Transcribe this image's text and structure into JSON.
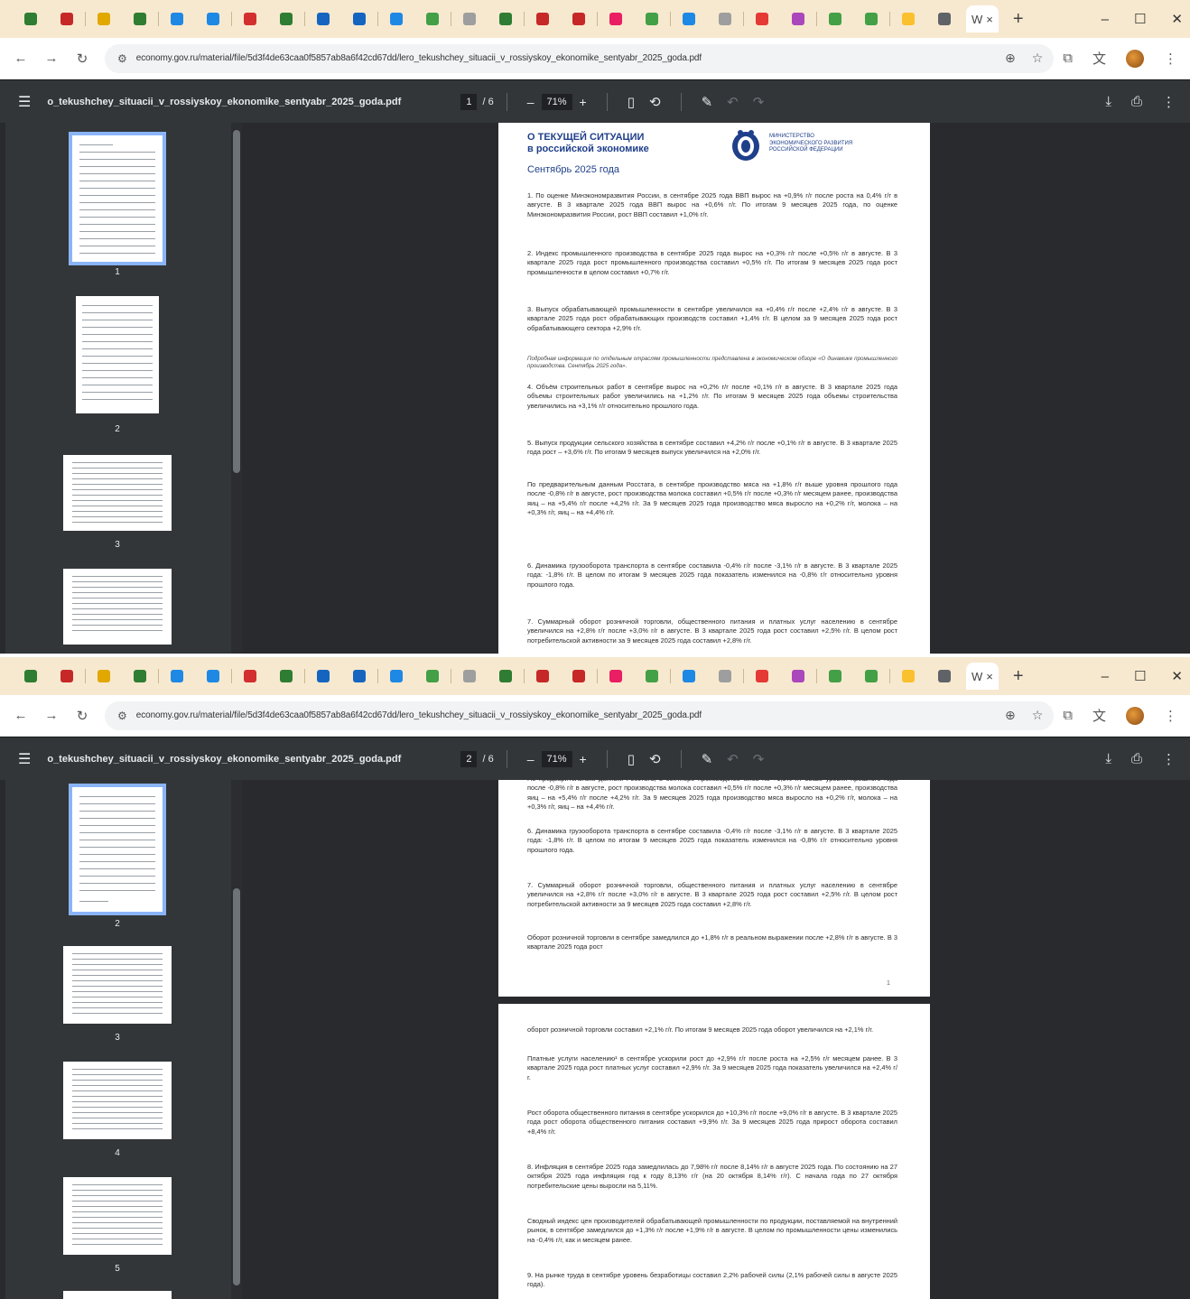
{
  "browser": {
    "pinned_tab_colors": [
      "#2e7d32",
      "#c62828",
      "#e0a800",
      "#2e7d32",
      "#1e88e5",
      "#1e88e5",
      "#d32f2f",
      "#2e7d32",
      "#1565c0",
      "#1565c0",
      "#1e88e5",
      "#43a047",
      "#9e9e9e",
      "#2e7d32",
      "#c62828",
      "#c62828",
      "#e91e63",
      "#43a047",
      "#1e88e5",
      "#9e9e9e",
      "#e53935",
      "#ab47bc",
      "#43a047",
      "#43a047",
      "#fbc02d",
      "#5f6368"
    ],
    "active_tab_icon": "W",
    "close_tab_glyph": "×",
    "new_tab_glyph": "+",
    "win_min": "–",
    "win_max": "☐",
    "win_close": "✕",
    "url": "economy.gov.ru/material/file/5d3f4de63caa0f5857ab8a6f42cd67dd/lero_tekushchey_situacii_v_rossiyskoy_ekonomike_sentyabr_2025_goda.pdf"
  },
  "pdf_viewer": {
    "file_name": "o_tekushchey_situacii_v_rossiyskoy_ekonomike_sentyabr_2025_goda.pdf",
    "total_pages": "/ 6",
    "zoom": "71%"
  },
  "screens": [
    {
      "current_page": "1",
      "thumb_labels": [
        "1",
        "2",
        "3"
      ]
    },
    {
      "current_page": "2",
      "thumb_labels": [
        "2",
        "3",
        "4",
        "5"
      ]
    }
  ],
  "document": {
    "title_line1": "О ТЕКУЩЕЙ СИТУАЦИИ",
    "title_line2": "в российской экономике",
    "subtitle": "Сентябрь 2025 года",
    "ministry_line1": "Министерство",
    "ministry_line2": "экономического развития",
    "ministry_line3": "Российской Федерации",
    "p1": "1. По оценке Минэкономразвития России, в сентябре 2025 года ВВП вырос на +0,9% г/г после роста на 0,4% г/г в августе. В 3 квартале 2025 года ВВП вырос на +0,6% г/г. По итогам 9 месяцев 2025 года, по оценке Минэкономразвития России, рост ВВП составил +1,0% г/г.",
    "p2": "2. Индекс промышленного производства в сентябре 2025 года вырос на +0,3% г/г после +0,5% г/г в августе. В 3 квартале 2025 года рост промышленного производства составил +0,5% г/г. По итогам 9 месяцев 2025 года рост промышленности в целом составил +0,7% г/г.",
    "p3": "3. Выпуск обрабатывающей промышленности в сентябре увеличился на +0,4% г/г после +2,4% г/г в августе. В 3 квартале 2025 года рост обрабатывающих производств составил +1,4% г/г. В целом за 9 месяцев 2025 года рост обрабатывающего сектора +2,9% г/г.",
    "note1": "Подробная информация по отдельным отраслям промышленности представлена в экономическом обзоре «О динамике промышленного производства. Сентябрь 2025 года».",
    "p4": "4. Объём строительных работ в сентябре вырос на +0,2% г/г после +0,1% г/г в августе. В 3 квартале 2025 года объемы строительных работ увеличились на +1,2% г/г. По итогам 9 месяцев 2025 года объемы строительства увеличились на +3,1% г/г относительно прошлого года.",
    "p5": "5. Выпуск продукции сельского хозяйства в сентябре составил +4,2% г/г после +0,1% г/г в августе. В 3 квартале 2025 года рост – +3,6% г/г. По итогам 9 месяцев выпуск увеличился на +2,0% г/г.",
    "p5b": "По предварительным данным Росстата, в сентябре производство мяса на +1,8% г/г выше уровня прошлого года после -0,8% г/г в августе, рост производства молока составил +0,5% г/г после +0,3% г/г месяцем ранее, производства яиц – на +5,4% г/г после +4,2% г/г. За 9 месяцев 2025 года производство мяса выросло на +0,2% г/г, молока – на +0,3% г/г, яиц – на +4,4% г/г.",
    "p6": "6. Динамика грузооборота транспорта в сентябре составила -0,4% г/г после -3,1% г/г в августе. В 3 квартале 2025 года: -1,8% г/г. В целом по итогам 9 месяцев 2025 года показатель изменился на -0,8% г/г относительно уровня прошлого года.",
    "p7": "7. Суммарный оборот розничной торговли, общественного питания и платных услуг населению в сентябре увеличился на +2,8% г/г после +3,0% г/г в августе. В 3 квартале 2025 года рост составил +2,5% г/г. В целом рост потребительской активности за 9 месяцев 2025 года составил +2,8% г/г.",
    "p7b": "Оборот розничной торговли в сентябре замедлился до +1,8% г/г в реальном выражении после +2,8% г/г в августе. В 3 квартале 2025 года рост",
    "page1_number": "1",
    "p8": "оборот розничной торговли составил +2,1% г/г. По итогам 9 месяцев 2025 года оборот увеличился на +2,1% г/г.",
    "p9": "Платные услуги населению¹ в сентябре ускорили рост до +2,9% г/г после роста на +2,5% г/г месяцем ранее. В 3 квартале 2025 года рост платных услуг составил +2,9% г/г. За 9 месяцев 2025 года показатель увеличился на +2,4% г/г.",
    "p10": "Рост оборота общественного питания в сентябре ускорился до +10,3% г/г после +9,0% г/г в августе. В 3 квартале 2025 года рост оборота общественного питания составил +9,9% г/г. За 9 месяцев 2025 года прирост оборота составил +8,4% г/г.",
    "p11": "8. Инфляция в сентябре 2025 года замедлилась до 7,98% г/г после 8,14% г/г в августе 2025 года. По состоянию на 27 октября 2025 года инфляция год к году 8,13% г/г (на 20 октября 8,14% г/г). С начала года по 27 октября потребительские цены выросли на 5,11%.",
    "p12": "Сводный индекс цен производителей обрабатывающей промышленности по продукции, поставляемой на внутренний рынок, в сентябре замедлился до +1,3% г/г после +1,9% г/г в августе. В целом по промышленности цены изменились на -0,4% г/г, как и месяцем ранее.",
    "p13": "9. На рынке труда в сентябре уровень безработицы составил 2,2% рабочей силы (2,1% рабочей силы в августе 2025 года)."
  }
}
